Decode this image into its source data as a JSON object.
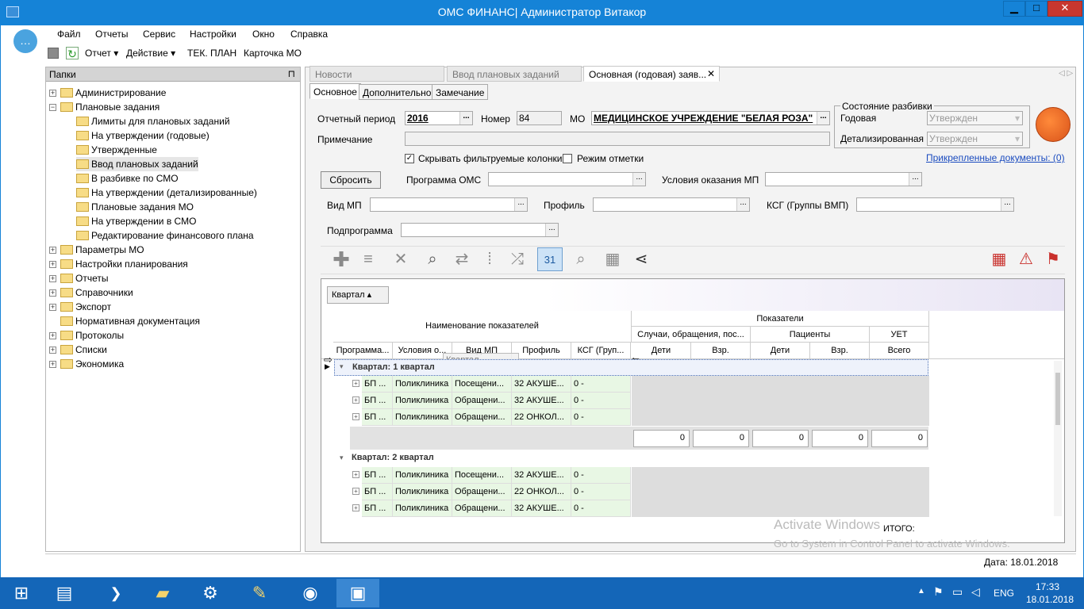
{
  "window": {
    "title": "ОМС ФИНАНС| Администратор Витакор",
    "min": "▁",
    "max": "□",
    "close": "✕"
  },
  "menu": [
    "Файл",
    "Отчеты",
    "Сервис",
    "Настройки",
    "Окно",
    "Справка"
  ],
  "toolbar": {
    "report": "Отчет",
    "action": "Действие",
    "tek_plan": "ТЕК. ПЛАН",
    "card": "Карточка МО"
  },
  "folders": {
    "title": "Папки",
    "pin": "⊓",
    "items": [
      {
        "label": "Администрирование",
        "level": 0,
        "exp": "+"
      },
      {
        "label": "Плановые задания",
        "level": 0,
        "exp": "−"
      },
      {
        "label": "Лимиты для плановых заданий",
        "level": 1
      },
      {
        "label": "На утверждении (годовые)",
        "level": 1
      },
      {
        "label": "Утвержденные",
        "level": 1
      },
      {
        "label": "Ввод плановых заданий",
        "level": 1,
        "selected": true
      },
      {
        "label": "В разбивке по СМО",
        "level": 1
      },
      {
        "label": "На утверждении (детализированные)",
        "level": 1
      },
      {
        "label": "Плановые задания МО",
        "level": 1
      },
      {
        "label": "На утверждении в СМО",
        "level": 1
      },
      {
        "label": "Редактирование финансового плана",
        "level": 1
      },
      {
        "label": "Параметры МО",
        "level": 0,
        "exp": "+"
      },
      {
        "label": "Настройки планирования",
        "level": 0,
        "exp": "+"
      },
      {
        "label": "Отчеты",
        "level": 0,
        "exp": "+"
      },
      {
        "label": "Справочники",
        "level": 0,
        "exp": "+"
      },
      {
        "label": "Экспорт",
        "level": 0,
        "exp": "+"
      },
      {
        "label": "Нормативная документация",
        "level": 0
      },
      {
        "label": "Протоколы",
        "level": 0,
        "exp": "+"
      },
      {
        "label": "Списки",
        "level": 0,
        "exp": "+"
      },
      {
        "label": "Экономика",
        "level": 0,
        "exp": "+"
      }
    ]
  },
  "doc_tabs": [
    "Новости",
    "Ввод плановых заданий",
    "Основная (годовая) заяв..."
  ],
  "sub_tabs": [
    "Основное",
    "Дополнительно",
    "Замечание"
  ],
  "form": {
    "period_label": "Отчетный период",
    "period_value": "2016",
    "number_label": "Номер",
    "number_value": "84",
    "mo_label": "МО",
    "mo_value": "МЕДИЦИНСКОЕ УЧРЕЖДЕНИЕ \"БЕЛАЯ РОЗА\"",
    "note_label": "Примечание",
    "state_group": "Состояние разбивки",
    "annual_label": "Годовая",
    "annual_value": "Утвержден",
    "detailed_label": "Детализированная",
    "detailed_value": "Утвержден",
    "docs_link": "Прикрепленные документы: (0)",
    "hide_filtered": "Скрывать фильтруемые колонки",
    "mark_mode": "Режим отметки",
    "reset": "Сбросить",
    "program_label": "Программа ОМС",
    "conditions_label": "Условия оказания МП",
    "vid_label": "Вид МП",
    "profile_label": "Профиль",
    "ksg_label": "КСГ (Группы ВМП)",
    "subprogram_label": "Подпрограмма"
  },
  "grid": {
    "group_chip": "Квартал ▴",
    "header_name": "Наименование показателей",
    "header_indicators": "Показатели",
    "h_cases": "Случаи, обращения, пос...",
    "h_patients": "Пациенты",
    "h_uet": "УЕТ",
    "h_children": "Дети",
    "h_adults": "Взр.",
    "h_total": "Всего",
    "cols": [
      "Программа...",
      "Условия о...",
      "Вид МП",
      "Профиль",
      "КСГ (Груп..."
    ],
    "drag_label": "Квартал",
    "group1": "Квартал: 1 квартал",
    "group2": "Квартал: 2 квартал",
    "rows1": [
      [
        "БП ...",
        "Поликлиника",
        "Посещени...",
        "32 АКУШЕ...",
        "0 -"
      ],
      [
        "БП ...",
        "Поликлиника",
        "Обращени...",
        "32 АКУШЕ...",
        "0 -"
      ],
      [
        "БП ...",
        "Поликлиника",
        "Обращени...",
        "22 ОНКОЛ...",
        "0 -"
      ]
    ],
    "totals": [
      "0",
      "0",
      "0",
      "0",
      "0"
    ],
    "rows2": [
      [
        "БП ...",
        "Поликлиника",
        "Посещени...",
        "32 АКУШЕ...",
        "0 -"
      ],
      [
        "БП ...",
        "Поликлиника",
        "Обращени...",
        "22 ОНКОЛ...",
        "0 -"
      ],
      [
        "БП ...",
        "Поликлиника",
        "Обращени...",
        "32 АКУШЕ...",
        "0 -"
      ]
    ],
    "itogo": "ИТОГО:"
  },
  "watermark": {
    "line1": "Activate Windows",
    "line2": "Go to System in Control Panel to activate Windows."
  },
  "status": {
    "date": "Дата: 18.01.2018"
  },
  "taskbar": {
    "lang": "ENG",
    "time": "17:33",
    "date": "18.01.2018"
  }
}
